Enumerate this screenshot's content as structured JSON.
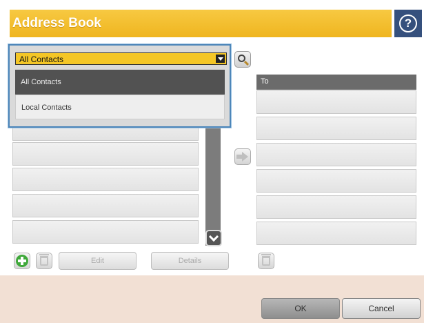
{
  "header": {
    "title": "Address Book",
    "help_icon": "help-icon"
  },
  "dropdown": {
    "selected": "All Contacts",
    "options": [
      "All Contacts",
      "Local Contacts"
    ]
  },
  "recipients": {
    "header": "To"
  },
  "actions": {
    "edit_label": "Edit",
    "details_label": "Details"
  },
  "footer": {
    "ok_label": "OK",
    "cancel_label": "Cancel"
  },
  "colors": {
    "accent": "#f4c626",
    "header_blue": "#35507d",
    "selection": "#4d86b9"
  }
}
